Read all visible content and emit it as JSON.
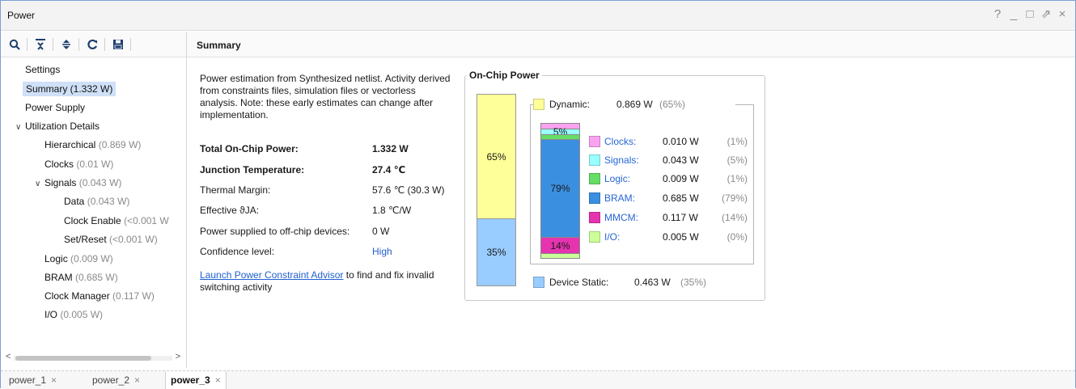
{
  "window": {
    "title": "Power",
    "controls": [
      "?",
      "_",
      "□",
      "⇗",
      "×"
    ]
  },
  "toolbar": {
    "icons": [
      "search-icon",
      "collapse-all-icon",
      "expand-all-icon",
      "refresh-icon",
      "save-icon"
    ]
  },
  "main": {
    "header": "Summary"
  },
  "tree": {
    "items": [
      {
        "label": "Settings",
        "value": ""
      },
      {
        "label": "Summary (1.332 W)",
        "value": ""
      },
      {
        "label": "Power Supply",
        "value": ""
      },
      {
        "label": "Utilization Details",
        "value": ""
      },
      {
        "label": "Hierarchical",
        "value": "(0.869 W)"
      },
      {
        "label": "Clocks",
        "value": "(0.01 W)"
      },
      {
        "label": "Signals",
        "value": "(0.043 W)"
      },
      {
        "label": "Data",
        "value": "(0.043 W)"
      },
      {
        "label": "Clock Enable",
        "value": "(<0.001 W"
      },
      {
        "label": "Set/Reset",
        "value": "(<0.001 W)"
      },
      {
        "label": "Logic",
        "value": "(0.009 W)"
      },
      {
        "label": "BRAM",
        "value": "(0.685 W)"
      },
      {
        "label": "Clock Manager",
        "value": "(0.117 W)"
      },
      {
        "label": "I/O",
        "value": "(0.005 W)"
      }
    ],
    "expander_collapse": "∨",
    "scroll_left": "<",
    "scroll_right": ">"
  },
  "summary": {
    "description": "Power estimation from Synthesized netlist. Activity derived from constraints files, simulation files or vectorless analysis. Note: these early estimates can change after implementation.",
    "rows": [
      {
        "label": "Total On-Chip Power:",
        "value": "1.332 W"
      },
      {
        "label": "Junction Temperature:",
        "value": "27.4 ℃"
      },
      {
        "label": "Thermal Margin:",
        "value": "57.6 ℃ (30.3 W)"
      },
      {
        "label": "Effective ϑJA:",
        "value": "1.8 ℃/W"
      },
      {
        "label": "Power supplied to off-chip devices:",
        "value": "0 W"
      },
      {
        "label": "Confidence level:",
        "value": "High"
      }
    ],
    "advisor_link": "Launch Power Constraint Advisor",
    "advisor_rest": " to find and fix invalid switching activity"
  },
  "onchip": {
    "title": "On-Chip Power",
    "dynamic": {
      "label": "Dynamic:",
      "watts": "0.869 W",
      "pct": "(65%)",
      "bar_label": "65%",
      "color": "#ffff99"
    },
    "static": {
      "label": "Device Static:",
      "watts": "0.463 W",
      "pct": "(35%)",
      "bar_label": "35%",
      "color": "#99ccff"
    },
    "categories": [
      {
        "name": "Clocks:",
        "watts": "0.010 W",
        "pct": "(1%)",
        "color": "#f9a3f0",
        "fraction": 0.0115
      },
      {
        "name": "Signals:",
        "watts": "0.043 W",
        "pct": "(5%)",
        "color": "#99ffff",
        "fraction": 0.0495
      },
      {
        "name": "Logic:",
        "watts": "0.009 W",
        "pct": "(1%)",
        "color": "#66dd66",
        "fraction": 0.0104
      },
      {
        "name": "BRAM:",
        "watts": "0.685 W",
        "pct": "(79%)",
        "color": "#3b8fe0",
        "fraction": 0.788
      },
      {
        "name": "MMCM:",
        "watts": "0.117 W",
        "pct": "(14%)",
        "color": "#e633b0",
        "fraction": 0.1346
      },
      {
        "name": "I/O:",
        "watts": "0.005 W",
        "pct": "(0%)",
        "color": "#ccff99",
        "fraction": 0.0058
      }
    ],
    "small_bar_labels": {
      "Signals": "5%",
      "BRAM": "79%",
      "MMCM": "14%"
    }
  },
  "tabs": [
    {
      "label": "power_1",
      "close": "×"
    },
    {
      "label": "power_2",
      "close": "×"
    },
    {
      "label": "power_3",
      "close": "×"
    }
  ]
}
